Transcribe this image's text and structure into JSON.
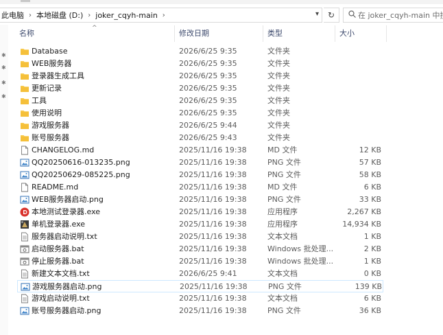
{
  "breadcrumb": [
    "此电脑",
    "本地磁盘 (D:)",
    "joker_cqyh-main"
  ],
  "search": {
    "placeholder": "在 joker_cqyh-main 中搜索"
  },
  "columns": {
    "name": "名称",
    "date": "修改日期",
    "type": "类型",
    "size": "大小"
  },
  "files": [
    {
      "name": "Database",
      "date": "2026/6/25 9:35",
      "type": "文件夹",
      "size": "",
      "icon": "folder-icon"
    },
    {
      "name": "WEB服务器",
      "date": "2026/6/25 9:35",
      "type": "文件夹",
      "size": "",
      "icon": "folder-icon"
    },
    {
      "name": "登录器生成工具",
      "date": "2026/6/25 9:35",
      "type": "文件夹",
      "size": "",
      "icon": "folder-icon"
    },
    {
      "name": "更新记录",
      "date": "2026/6/25 9:35",
      "type": "文件夹",
      "size": "",
      "icon": "folder-icon"
    },
    {
      "name": "工具",
      "date": "2026/6/25 9:35",
      "type": "文件夹",
      "size": "",
      "icon": "folder-icon"
    },
    {
      "name": "使用说明",
      "date": "2026/6/25 9:35",
      "type": "文件夹",
      "size": "",
      "icon": "folder-icon"
    },
    {
      "name": "游戏服务器",
      "date": "2026/6/25 9:44",
      "type": "文件夹",
      "size": "",
      "icon": "folder-icon"
    },
    {
      "name": "账号服务器",
      "date": "2026/6/25 9:43",
      "type": "文件夹",
      "size": "",
      "icon": "folder-icon"
    },
    {
      "name": "CHANGELOG.md",
      "date": "2025/11/16 19:38",
      "type": "MD 文件",
      "size": "12 KB",
      "icon": "document-icon"
    },
    {
      "name": "QQ20250616-013235.png",
      "date": "2025/11/16 19:38",
      "type": "PNG 文件",
      "size": "57 KB",
      "icon": "image-icon"
    },
    {
      "name": "QQ20250629-085225.png",
      "date": "2025/11/16 19:38",
      "type": "PNG 文件",
      "size": "58 KB",
      "icon": "image-icon"
    },
    {
      "name": "README.md",
      "date": "2025/11/16 19:38",
      "type": "MD 文件",
      "size": "6 KB",
      "icon": "document-icon"
    },
    {
      "name": "WEB服务器启动.png",
      "date": "2025/11/16 19:38",
      "type": "PNG 文件",
      "size": "33 KB",
      "icon": "image-icon"
    },
    {
      "name": "本地测试登录器.exe",
      "date": "2025/11/16 19:38",
      "type": "应用程序",
      "size": "2,267 KB",
      "icon": "red-app-icon"
    },
    {
      "name": "单机登录器.exe",
      "date": "2025/11/16 19:38",
      "type": "应用程序",
      "size": "14,934 KB",
      "icon": "dark-app-icon"
    },
    {
      "name": "服务器启动说明.txt",
      "date": "2025/11/16 19:38",
      "type": "文本文档",
      "size": "1 KB",
      "icon": "text-icon"
    },
    {
      "name": "启动服务器.bat",
      "date": "2025/11/16 19:38",
      "type": "Windows 批处理...",
      "size": "2 KB",
      "icon": "batch-icon"
    },
    {
      "name": "停止服务器.bat",
      "date": "2025/11/16 19:38",
      "type": "Windows 批处理...",
      "size": "1 KB",
      "icon": "batch-icon"
    },
    {
      "name": "新建文本文档.txt",
      "date": "2026/6/25 9:41",
      "type": "文本文档",
      "size": "0 KB",
      "icon": "text-icon"
    },
    {
      "name": "游戏服务器启动.png",
      "date": "2025/11/16 19:38",
      "type": "PNG 文件",
      "size": "139 KB",
      "icon": "image-icon",
      "selected": true
    },
    {
      "name": "游戏启动说明.txt",
      "date": "2025/11/16 19:38",
      "type": "文本文档",
      "size": "6 KB",
      "icon": "text-icon"
    },
    {
      "name": "账号服务器启动.png",
      "date": "2025/11/16 19:38",
      "type": "PNG 文件",
      "size": "36 KB",
      "icon": "image-icon"
    }
  ],
  "colors": {
    "folder": "#f8c94a",
    "accent": "#3d4a6d",
    "image_border": "#2f6fb5",
    "selection_border": "#cde8ff"
  }
}
